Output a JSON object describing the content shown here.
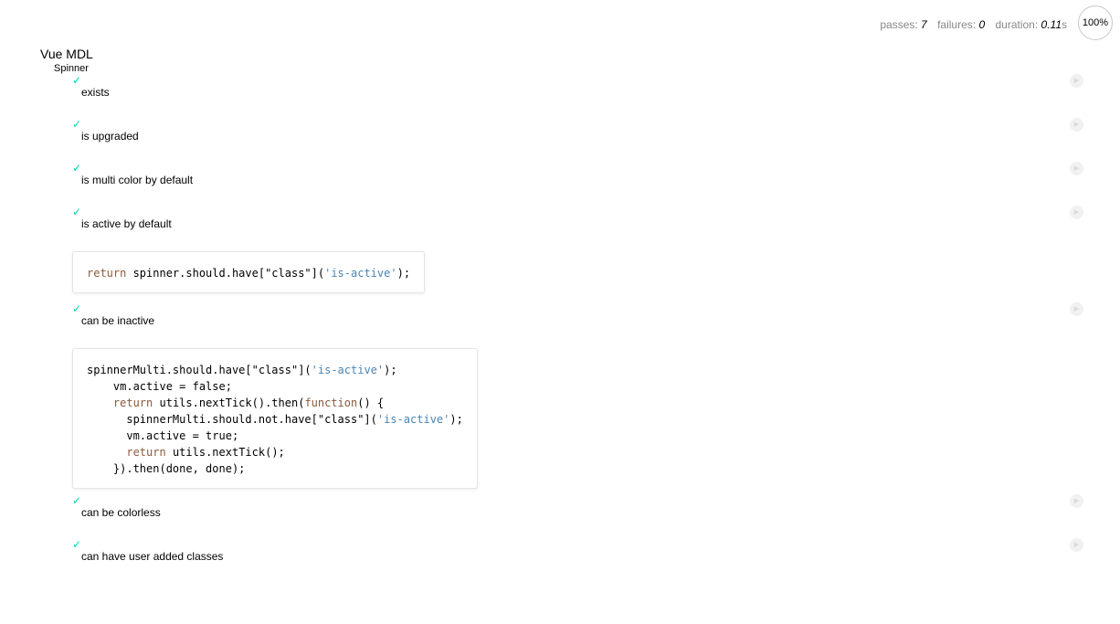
{
  "stats": {
    "passes_label": "passes:",
    "passes": "7",
    "failures_label": "failures:",
    "failures": "0",
    "duration_label": "duration:",
    "duration": "0.11",
    "duration_unit": "s",
    "progress": "100%"
  },
  "suite": {
    "title": "Vue MDL",
    "subsuite_title": "Spinner"
  },
  "tests": [
    {
      "status_icon": "✓",
      "title": "exists",
      "replay_icon": "▶"
    },
    {
      "status_icon": "✓",
      "title": "is upgraded",
      "replay_icon": "▶"
    },
    {
      "status_icon": "✓",
      "title": "is multi color by default",
      "replay_icon": "▶"
    },
    {
      "status_icon": "✓",
      "title": "is active by default",
      "replay_icon": "▶",
      "code": "return spinner.should.have[\"class\"]('is-active');"
    },
    {
      "status_icon": "✓",
      "title": "can be inactive",
      "replay_icon": "▶",
      "code": "spinnerMulti.should.have[\"class\"]('is-active');\n    vm.active = false;\n    return utils.nextTick().then(function() {\n      spinnerMulti.should.not.have[\"class\"]('is-active');\n      vm.active = true;\n      return utils.nextTick();\n    }).then(done, done);"
    },
    {
      "status_icon": "✓",
      "title": "can be colorless",
      "replay_icon": "▶"
    },
    {
      "status_icon": "✓",
      "title": "can have user added classes",
      "replay_icon": "▶"
    }
  ],
  "colors": {
    "pass": "#00d6b2",
    "keyword": "#8b5a3c",
    "string": "#4a84b3"
  }
}
